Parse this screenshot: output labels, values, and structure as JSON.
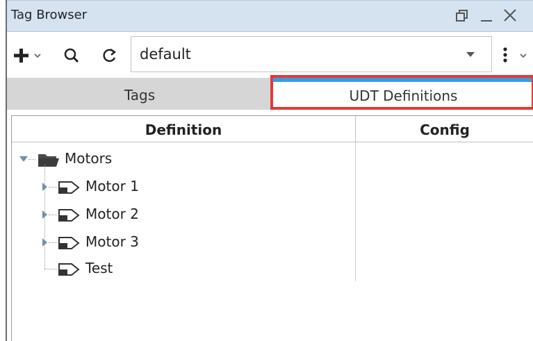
{
  "window": {
    "title": "Tag Browser",
    "restore_icon": "restore-icon",
    "minimize_icon": "minimize-icon",
    "close_icon": "close-icon"
  },
  "toolbar": {
    "add_icon": "plus-icon",
    "search_icon": "search-icon",
    "refresh_icon": "refresh-icon",
    "provider_value": "default",
    "menu_icon": "kebab-menu-icon"
  },
  "tabs": [
    {
      "label": "Tags",
      "active": false
    },
    {
      "label": "UDT Definitions",
      "active": true
    }
  ],
  "table": {
    "columns": [
      "Definition",
      "Config"
    ],
    "tree": {
      "folder": {
        "label": "Motors",
        "expanded": true
      },
      "items": [
        {
          "label": "Motor 1",
          "expandable": true
        },
        {
          "label": "Motor 2",
          "expandable": true
        },
        {
          "label": "Motor 3",
          "expandable": true
        },
        {
          "label": "Test",
          "expandable": false
        }
      ]
    }
  },
  "colors": {
    "titlebar": "#d5e3f1",
    "active_tab_accent": "#3b9be0",
    "highlight_border": "#e53935",
    "inactive_tab": "#d6d6d6"
  }
}
